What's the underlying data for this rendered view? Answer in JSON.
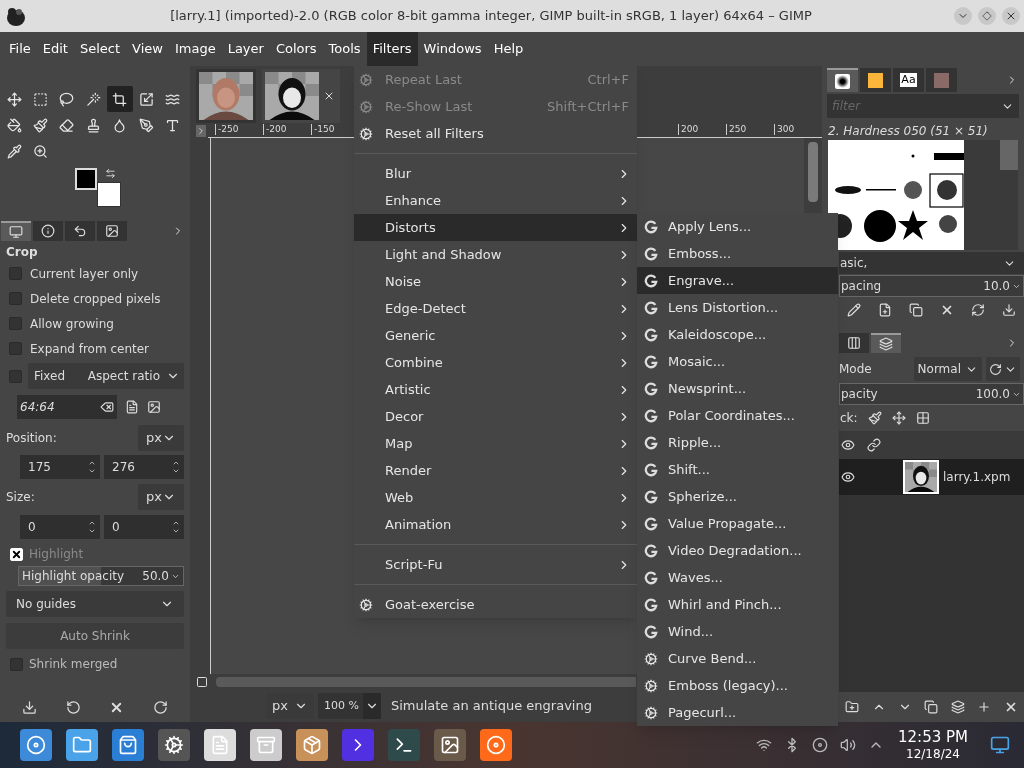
{
  "window": {
    "title": "[larry.1] (imported)-2.0 (RGB color 8-bit gamma integer, GIMP built-in sRGB, 1 layer) 64x64 – GIMP"
  },
  "menubar": [
    {
      "label": "File",
      "selected": false
    },
    {
      "label": "Edit",
      "selected": false
    },
    {
      "label": "Select",
      "selected": false
    },
    {
      "label": "View",
      "selected": false
    },
    {
      "label": "Image",
      "selected": false
    },
    {
      "label": "Layer",
      "selected": false
    },
    {
      "label": "Colors",
      "selected": false
    },
    {
      "label": "Tools",
      "selected": false
    },
    {
      "label": "Filters",
      "selected": true
    },
    {
      "label": "Windows",
      "selected": false
    },
    {
      "label": "Help",
      "selected": false
    }
  ],
  "toolbox": {
    "tools": [
      {
        "selected": false
      },
      {
        "selected": false
      },
      {
        "selected": false
      },
      {
        "selected": false
      },
      {
        "selected": true
      },
      {
        "selected": false
      },
      {
        "selected": false
      },
      {
        "selected": false
      },
      {
        "selected": false
      },
      {
        "selected": false
      },
      {
        "selected": false
      },
      {
        "selected": false
      },
      {
        "selected": false
      },
      {
        "selected": false
      },
      {
        "selected": false
      },
      {
        "selected": false
      }
    ]
  },
  "tool_options": {
    "tabs": [
      {
        "selected": true
      },
      {
        "selected": false
      },
      {
        "selected": false
      },
      {
        "selected": false
      }
    ],
    "title": "Crop",
    "checkboxes": [
      {
        "label": "Current layer only",
        "checked": false
      },
      {
        "label": "Delete cropped pixels",
        "checked": false
      },
      {
        "label": "Allow growing",
        "checked": false
      },
      {
        "label": "Expand from center",
        "checked": false
      }
    ],
    "fixed": {
      "label": "Fixed",
      "checked": false,
      "mode": "Aspect ratio"
    },
    "ratio": "64:64",
    "position": {
      "label": "Position:",
      "unit": "px",
      "values": [
        "175",
        "276"
      ]
    },
    "size": {
      "label": "Size:",
      "unit": "px",
      "values": [
        "0",
        "0"
      ]
    },
    "highlight": {
      "label": "Highlight",
      "checked": true
    },
    "highlight_opacity": {
      "label": "Highlight opacity",
      "value": "50.0",
      "level": 0.5
    },
    "guides": "No guides",
    "auto_shrink": "Auto Shrink",
    "shrink_merged": {
      "label": "Shrink merged",
      "checked": false
    }
  },
  "image_tabs": [
    {
      "selected": false
    },
    {
      "selected": true
    }
  ],
  "ruler": {
    "labels": [
      "-250",
      "-200",
      "-150",
      "200",
      "250",
      "300"
    ]
  },
  "status": {
    "unit": "px",
    "zoom": "100 %",
    "message": "Simulate an antique engraving"
  },
  "filters_menu": [
    {
      "kind": "action",
      "label": "Repeat Last",
      "shortcut": "Ctrl+F",
      "disabled": true
    },
    {
      "kind": "action",
      "label": "Re-Show Last",
      "shortcut": "Shift+Ctrl+F",
      "disabled": true
    },
    {
      "kind": "action",
      "label": "Reset all Filters",
      "disabled": false
    },
    {
      "kind": "separator"
    },
    {
      "kind": "submenu",
      "label": "Blur",
      "selected": false
    },
    {
      "kind": "submenu",
      "label": "Enhance",
      "selected": false
    },
    {
      "kind": "submenu",
      "label": "Distorts",
      "selected": true
    },
    {
      "kind": "submenu",
      "label": "Light and Shadow",
      "selected": false
    },
    {
      "kind": "submenu",
      "label": "Noise",
      "selected": false
    },
    {
      "kind": "submenu",
      "label": "Edge-Detect",
      "selected": false
    },
    {
      "kind": "submenu",
      "label": "Generic",
      "selected": false
    },
    {
      "kind": "submenu",
      "label": "Combine",
      "selected": false
    },
    {
      "kind": "submenu",
      "label": "Artistic",
      "selected": false
    },
    {
      "kind": "submenu",
      "label": "Decor",
      "selected": false
    },
    {
      "kind": "submenu",
      "label": "Map",
      "selected": false
    },
    {
      "kind": "submenu",
      "label": "Render",
      "selected": false
    },
    {
      "kind": "submenu",
      "label": "Web",
      "selected": false
    },
    {
      "kind": "submenu",
      "label": "Animation",
      "selected": false
    },
    {
      "kind": "separator"
    },
    {
      "kind": "submenu",
      "label": "Script-Fu",
      "selected": false
    },
    {
      "kind": "separator"
    },
    {
      "kind": "action",
      "label": "Goat-exercise",
      "disabled": false
    }
  ],
  "distorts_menu": [
    {
      "kind": "gegl",
      "label": "Apply Lens...",
      "selected": false
    },
    {
      "kind": "gegl",
      "label": "Emboss...",
      "selected": false
    },
    {
      "kind": "gegl",
      "label": "Engrave...",
      "selected": true
    },
    {
      "kind": "gegl",
      "label": "Lens Distortion...",
      "selected": false
    },
    {
      "kind": "gegl",
      "label": "Kaleidoscope...",
      "selected": false
    },
    {
      "kind": "gegl",
      "label": "Mosaic...",
      "selected": false
    },
    {
      "kind": "gegl",
      "label": "Newsprint...",
      "selected": false
    },
    {
      "kind": "gegl",
      "label": "Polar Coordinates...",
      "selected": false
    },
    {
      "kind": "gegl",
      "label": "Ripple...",
      "selected": false
    },
    {
      "kind": "gegl",
      "label": "Shift...",
      "selected": false
    },
    {
      "kind": "gegl",
      "label": "Spherize...",
      "selected": false
    },
    {
      "kind": "gegl",
      "label": "Value Propagate...",
      "selected": false
    },
    {
      "kind": "gegl",
      "label": "Video Degradation...",
      "selected": false
    },
    {
      "kind": "gegl",
      "label": "Waves...",
      "selected": false
    },
    {
      "kind": "gegl",
      "label": "Whirl and Pinch...",
      "selected": false
    },
    {
      "kind": "gegl",
      "label": "Wind...",
      "selected": false
    },
    {
      "kind": "script",
      "label": "Curve Bend...",
      "selected": false
    },
    {
      "kind": "script",
      "label": "Emboss (legacy)...",
      "selected": false
    },
    {
      "kind": "script",
      "label": "Pagecurl...",
      "selected": false
    }
  ],
  "brushes": {
    "tabs": [
      {
        "selected": true
      },
      {
        "selected": false
      },
      {
        "selected": false,
        "label": "Aa"
      },
      {
        "selected": false
      }
    ],
    "filter_placeholder": "filter",
    "brush_name": "2. Hardness 050 (51 × 51)",
    "tag": "asic,",
    "spacing": {
      "label": "pacing",
      "value": "10.0"
    }
  },
  "layers": {
    "tabs": [
      {
        "selected": false
      },
      {
        "selected": true
      }
    ],
    "mode": {
      "label": "Mode",
      "value": "Normal"
    },
    "opacity": {
      "label": "pacity",
      "value": "100.0"
    },
    "lock_label": "ck:",
    "items": [
      {
        "name": "larry.1.xpm",
        "visible": true,
        "selected": true
      }
    ]
  },
  "taskbar": {
    "time": "12:53 PM",
    "date": "12/18/24"
  }
}
